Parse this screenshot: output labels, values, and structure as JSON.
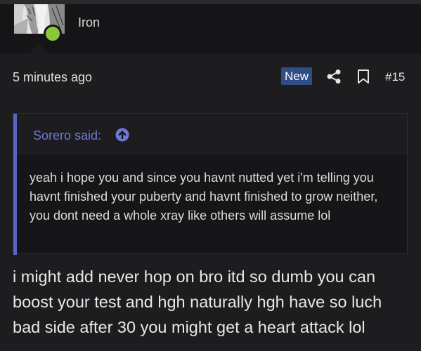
{
  "author": {
    "username": "Iron",
    "status": "online"
  },
  "meta": {
    "timestamp": "5 minutes ago",
    "badge": "New",
    "post_number": "#15"
  },
  "quote": {
    "author_label": "Sorero said:",
    "text": "yeah i hope you and since you havnt nutted yet i'm telling you havnt finished your puberty and havnt finished to grow neither, you dont need a whole xray like others will assume lol"
  },
  "message": {
    "text": "i might add never hop on bro itd so dumb you can boost your test and hgh naturally hgh have so luch bad side after 30 you might get a heart attack lol"
  },
  "colors": {
    "accent": "#6f78d8",
    "badge": "#2f4e86",
    "online": "#8ac73b"
  },
  "icons": {
    "share": "share-icon",
    "bookmark": "bookmark-icon",
    "quote_jump": "arrow-up-circle-icon"
  }
}
